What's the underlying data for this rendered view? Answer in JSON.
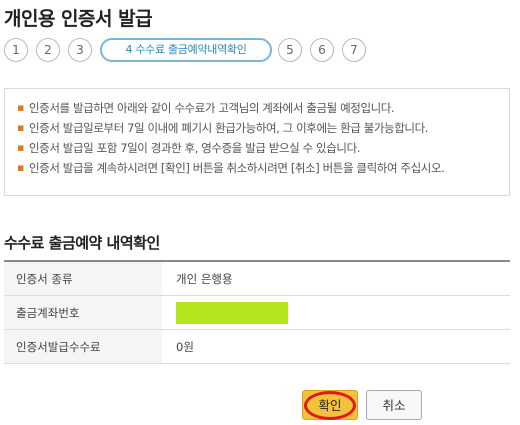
{
  "page": {
    "title": "개인용 인증서 발급"
  },
  "steps": [
    {
      "label": "1",
      "current": false
    },
    {
      "label": "2",
      "current": false
    },
    {
      "label": "3",
      "current": false
    },
    {
      "label": "4 수수료 출금예약내역확인",
      "current": true
    },
    {
      "label": "5",
      "current": false
    },
    {
      "label": "6",
      "current": false
    },
    {
      "label": "7",
      "current": false
    }
  ],
  "notice": {
    "items": [
      "인증서를 발급하면 아래와 같이 수수료가 고객님의 계좌에서 출금될 예정입니다.",
      "인증서 발급일로부터 7일 이내에 폐기시 환급가능하여, 그 이후에는 환급 불가능합니다.",
      "인증서 발급일 포함 7일이 경과한 후, 영수증을 발급 받으실 수 있습니다.",
      "인증서 발급을 계속하시려면 [확인] 버튼을 취소하시려면 [취소] 버튼을 클릭하여 주십시오."
    ]
  },
  "section": {
    "title": "수수료 출금예약 내역확인"
  },
  "table": {
    "rows": [
      {
        "label": "인증서 종류",
        "value": "개인 은행용"
      },
      {
        "label": "출금계좌번호",
        "value": ""
      },
      {
        "label": "인증서발급수수료",
        "value": "0원"
      }
    ]
  },
  "buttons": {
    "confirm": "확인",
    "cancel": "취소"
  },
  "colors": {
    "accent": "#7ab7d6",
    "confirm": "#f3c23b",
    "bullet": "#e2761b",
    "mask": "#b5e61d"
  }
}
